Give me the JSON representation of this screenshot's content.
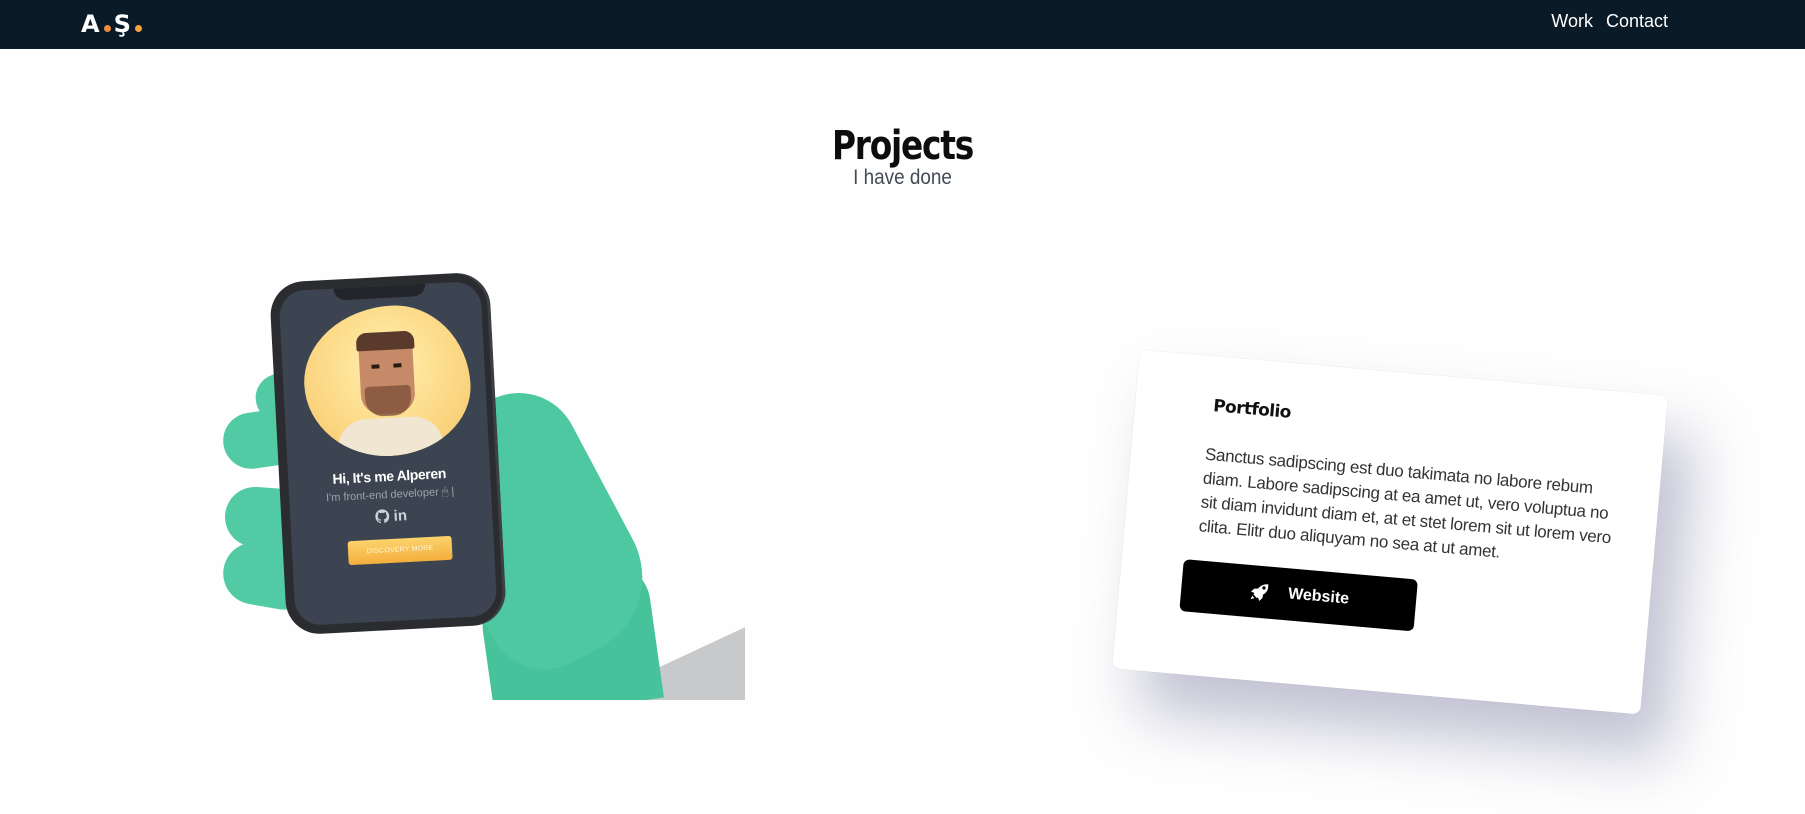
{
  "nav": {
    "logo": {
      "first": "A",
      "second": "Ş"
    },
    "links": [
      {
        "label": "Work"
      },
      {
        "label": "Contact"
      }
    ]
  },
  "section": {
    "title": "Projects",
    "subtitle": "I have done"
  },
  "illustration": {
    "phone": {
      "name": "Hi, It's me Alperen",
      "role": "I'm front-end developer 🖱 |",
      "icons": [
        "github-icon",
        "linkedin-icon"
      ],
      "icons_text": "in",
      "cta_label": "DISCOVERY MORE"
    }
  },
  "project_card": {
    "title": "Portfolio",
    "description": "Sanctus sadipscing est duo takimata no labore rebum diam. Labore sadipscing at ea amet ut, vero voluptua no sit diam invidunt diam et, at et stet lorem sit ut lorem vero clita. Elitr duo aliquyam no sea at ut amet.",
    "button_label": "Website",
    "button_icon": "rocket-icon"
  },
  "colors": {
    "navbar_bg": "#0a1a26",
    "logo_dot_1": "#f08c3a",
    "logo_dot_2": "#f4a23c",
    "hand": "#4ec8a0",
    "card_button_bg": "#000000"
  }
}
